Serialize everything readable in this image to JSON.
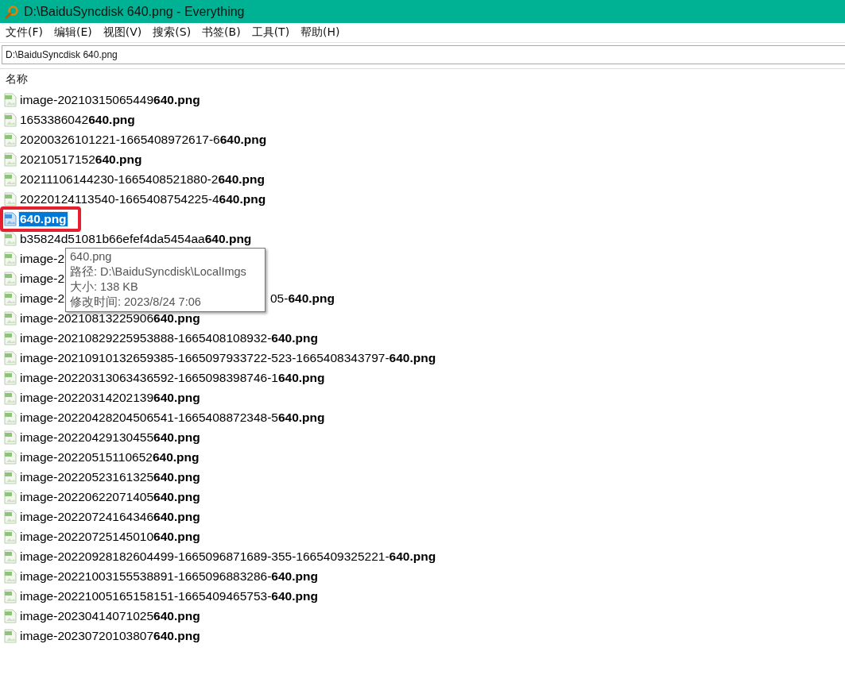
{
  "window": {
    "title": "D:\\BaiduSyncdisk 640.png - Everything"
  },
  "menu": [
    "文件(F)",
    "编辑(E)",
    "视图(V)",
    "搜索(S)",
    "书签(B)",
    "工具(T)",
    "帮助(H)"
  ],
  "search": {
    "value": "D:\\BaiduSyncdisk 640.png"
  },
  "table": {
    "columns": [
      "名称"
    ],
    "rows": [
      {
        "name": "image-20210315065449**640.png**",
        "selected": false,
        "annotated": false
      },
      {
        "name": "1653386042**640.png**",
        "selected": false,
        "annotated": false
      },
      {
        "name": "20200326101221-1665408972617-6**640.png**",
        "selected": false,
        "annotated": false
      },
      {
        "name": "20210517152**640.png**",
        "selected": false,
        "annotated": false
      },
      {
        "name": "20211106144230-1665408521880-2**640.png**",
        "selected": false,
        "annotated": false
      },
      {
        "name": "20220124113540-1665408754225-4**640.png**",
        "selected": false,
        "annotated": false
      },
      {
        "name": "**640.png**",
        "selected": true,
        "annotated": true
      },
      {
        "name": "b35824d51081b66efef4da5454aa**640.png**",
        "selected": false,
        "annotated": false
      },
      {
        "name": "image-2",
        "selected": false,
        "annotated": false
      },
      {
        "name": "image-2",
        "selected": false,
        "annotated": false
      },
      {
        "name": "image-2",
        "tail": "05-**640.png**",
        "selected": false,
        "annotated": false
      },
      {
        "name": "image-20210813225906**640.png**",
        "selected": false,
        "annotated": false
      },
      {
        "name": "image-20210829225953888-1665408108932-**640.png**",
        "selected": false,
        "annotated": false
      },
      {
        "name": "image-20210910132659385-1665097933722-523-1665408343797-**640.png**",
        "selected": false,
        "annotated": false
      },
      {
        "name": "image-20220313063436592-1665098398746-1**640.png**",
        "selected": false,
        "annotated": false
      },
      {
        "name": "image-20220314202139**640.png**",
        "selected": false,
        "annotated": false
      },
      {
        "name": "image-20220428204506541-1665408872348-5**640.png**",
        "selected": false,
        "annotated": false
      },
      {
        "name": "image-20220429130455**640.png**",
        "selected": false,
        "annotated": false
      },
      {
        "name": "image-20220515110652**640.png**",
        "selected": false,
        "annotated": false
      },
      {
        "name": "image-20220523161325**640.png**",
        "selected": false,
        "annotated": false
      },
      {
        "name": "image-20220622071405**640.png**",
        "selected": false,
        "annotated": false
      },
      {
        "name": "image-20220724164346**640.png**",
        "selected": false,
        "annotated": false
      },
      {
        "name": "image-20220725145010**640.png**",
        "selected": false,
        "annotated": false
      },
      {
        "name": "image-20220928182604499-1665096871689-355-1665409325221-**640.png**",
        "selected": false,
        "annotated": false
      },
      {
        "name": "image-20221003155538891-1665096883286-**640.png**",
        "selected": false,
        "annotated": false
      },
      {
        "name": "image-20221005165158151-1665409465753-**640.png**",
        "selected": false,
        "annotated": false
      },
      {
        "name": "image-20230414071025**640.png**",
        "selected": false,
        "annotated": false
      },
      {
        "name": "image-20230720103807**640.png**",
        "selected": false,
        "annotated": false
      }
    ]
  },
  "tooltip": {
    "lines": [
      "640.png",
      "路径: D:\\BaiduSyncdisk\\LocalImgs",
      "大小: 138 KB",
      "修改时间: 2023/8/24 7:06"
    ]
  }
}
